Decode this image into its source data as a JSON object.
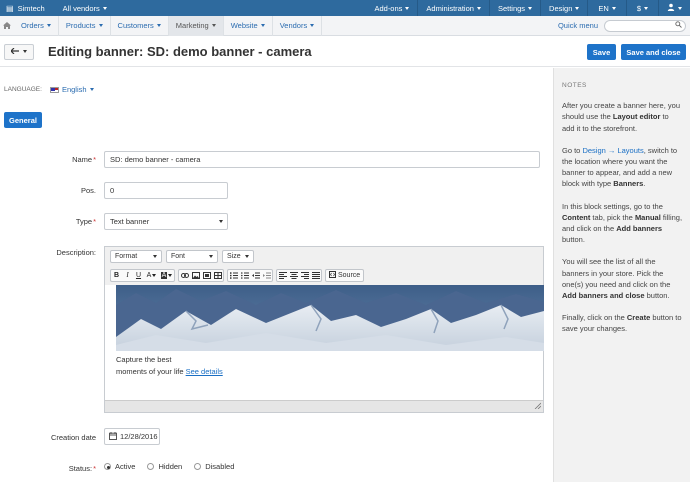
{
  "topbar": {
    "brand": "Simtech",
    "vendor": "All vendors",
    "addons": "Add-ons",
    "administration": "Administration",
    "settings": "Settings",
    "design": "Design",
    "lang": "EN",
    "currency": "$"
  },
  "nav": {
    "items": [
      "Orders",
      "Products",
      "Customers",
      "Marketing",
      "Website",
      "Vendors"
    ],
    "quick_menu": "Quick menu"
  },
  "header": {
    "title": "Editing banner: SD: demo banner - camera",
    "save": "Save",
    "save_close": "Save and close"
  },
  "language": {
    "label": "LANGUAGE:",
    "value": "English"
  },
  "tabs": {
    "general": "General"
  },
  "form": {
    "name_label": "Name",
    "name_value": "SD: demo banner - camera",
    "pos_label": "Pos.",
    "pos_value": "0",
    "type_label": "Type",
    "type_value": "Text banner",
    "description_label": "Description:",
    "creation_date_label": "Creation date",
    "creation_date_value": "12/28/2016",
    "status_label": "Status:",
    "status_options": [
      "Active",
      "Hidden",
      "Disabled"
    ],
    "status_selected": "Active"
  },
  "editor": {
    "format": "Format",
    "font": "Font",
    "size": "Size",
    "source": "Source",
    "caption_line1": "Capture the best",
    "caption_line2": "moments of your life",
    "caption_link": "See details"
  },
  "notes": {
    "heading": "NOTES",
    "p1_a": "After you create a banner here, you should use the ",
    "p1_b": "Layout editor",
    "p1_c": " to add it to the storefront.",
    "p2_a": "Go to ",
    "p2_link": "Design → Layouts",
    "p2_b": ", switch to the location where you want the banner to appear, and add a new block with type ",
    "p2_c": "Banners",
    "p2_d": ".",
    "p3_a": "In this block settings, go to the ",
    "p3_b": "Content",
    "p3_c": " tab, pick the ",
    "p3_d": "Manual",
    "p3_e": " filling, and click on the ",
    "p3_f": "Add banners",
    "p3_g": " button.",
    "p4_a": "You will see the list of all the banners in your store. Pick the one(s) you need and click on the ",
    "p4_b": "Add banners and close",
    "p4_c": " button.",
    "p5_a": "Finally, click on the ",
    "p5_b": "Create",
    "p5_c": " button to save your changes."
  },
  "colors": {
    "topbar": "#2e6a9e",
    "primary_button": "#1e73c9",
    "link": "#1a6fc4"
  }
}
